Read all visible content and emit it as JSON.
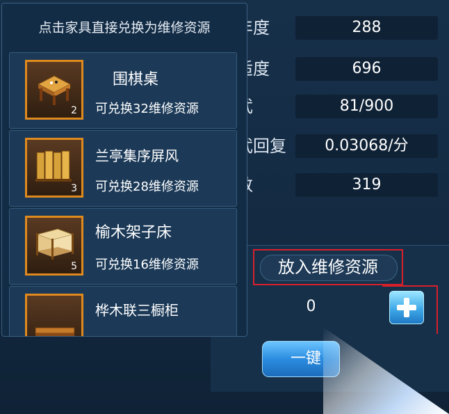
{
  "stats": [
    {
      "label": "年度",
      "value": "288"
    },
    {
      "label": "适度",
      "value": "696"
    },
    {
      "label": "武",
      "value": "81/900"
    },
    {
      "label": "武回复",
      "value": "0.03068/分"
    },
    {
      "label": "数",
      "value": "319"
    }
  ],
  "exchange_panel": {
    "title": "点击家具直接兑换为维修资源",
    "items": [
      {
        "name": "围棋桌",
        "count": "2",
        "reward": "可兑换32维修资源",
        "icon": "go-table-icon"
      },
      {
        "name": "兰亭集序屏风",
        "count": "3",
        "reward": "可兑换28维修资源",
        "icon": "folding-screen-icon"
      },
      {
        "name": "榆木架子床",
        "count": "5",
        "reward": "可兑换16维修资源",
        "icon": "canopy-bed-icon"
      },
      {
        "name": "桦木联三橱柜",
        "count": "",
        "reward": "",
        "icon": "cabinet-icon"
      }
    ]
  },
  "deposit": {
    "label": "放入维修资源"
  },
  "quantity": {
    "value": "0"
  },
  "one_key": {
    "label": "一键"
  },
  "colors": {
    "highlight_border": "#d8202a",
    "item_frame": "#e08a1e",
    "button_blue": "#2b8de0"
  }
}
